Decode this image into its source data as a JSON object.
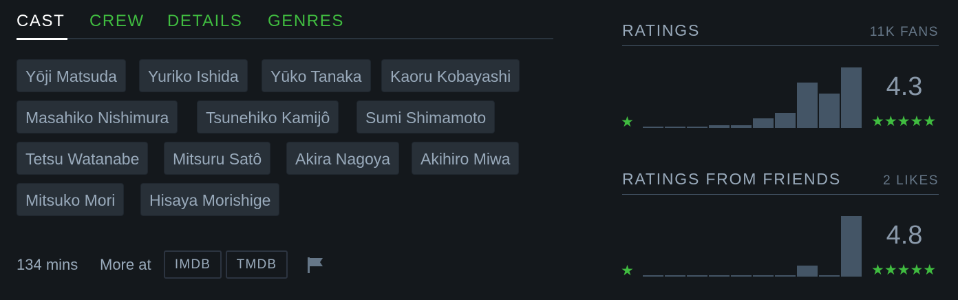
{
  "tabs": [
    {
      "label": "CAST",
      "active": true
    },
    {
      "label": "CREW",
      "active": false
    },
    {
      "label": "DETAILS",
      "active": false
    },
    {
      "label": "GENRES",
      "active": false
    }
  ],
  "cast": [
    "Yōji Matsuda",
    "Yuriko Ishida",
    "Yūko Tanaka",
    "Kaoru Kobayashi",
    "Masahiko Nishimura",
    "Tsunehiko Kamijô",
    "Sumi Shimamoto",
    "Tetsu Watanabe",
    "Mitsuru Satô",
    "Akira Nagoya",
    "Akihiro Miwa",
    "Mitsuko Mori",
    "Hisaya Morishige"
  ],
  "footer": {
    "runtime": "134 mins",
    "more_at": "More at",
    "imdb": "IMDB",
    "tmdb": "TMDB",
    "flag_icon": "flag-icon"
  },
  "ratings": {
    "title": "RATINGS",
    "fans": "11K FANS",
    "average": "4.3",
    "histogram": [
      1,
      1,
      1,
      2,
      2,
      7,
      11,
      33,
      25,
      44
    ],
    "max_value": 44
  },
  "friends": {
    "title": "RATINGS FROM FRIENDS",
    "likes": "2 LIKES",
    "average": "4.8",
    "histogram": [
      0,
      0,
      0,
      0,
      0,
      0,
      0,
      2,
      0,
      11
    ],
    "max_value": 11
  },
  "colors": {
    "accent_green": "#40bc40",
    "bar": "#456",
    "background": "#14181c",
    "chip": "#283038"
  },
  "star_glyph_single": "★",
  "star_glyph_five": "★★★★★"
}
